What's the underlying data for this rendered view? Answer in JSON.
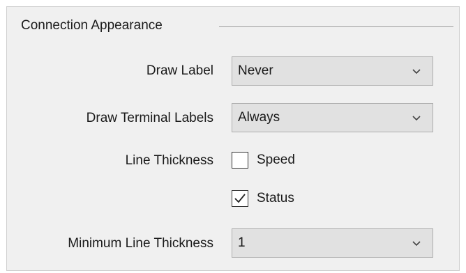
{
  "group": {
    "title": "Connection Appearance"
  },
  "draw_label": {
    "label": "Draw Label",
    "value": "Never"
  },
  "draw_terminal_labels": {
    "label": "Draw Terminal Labels",
    "value": "Always"
  },
  "line_thickness": {
    "label": "Line Thickness",
    "options": [
      {
        "label": "Speed",
        "checked": false
      },
      {
        "label": "Status",
        "checked": true
      }
    ]
  },
  "minimum_line_thickness": {
    "label": "Minimum Line Thickness",
    "value": "1"
  },
  "icons": {
    "dropdown": "chevron-down-icon",
    "check": "checkmark-icon"
  }
}
